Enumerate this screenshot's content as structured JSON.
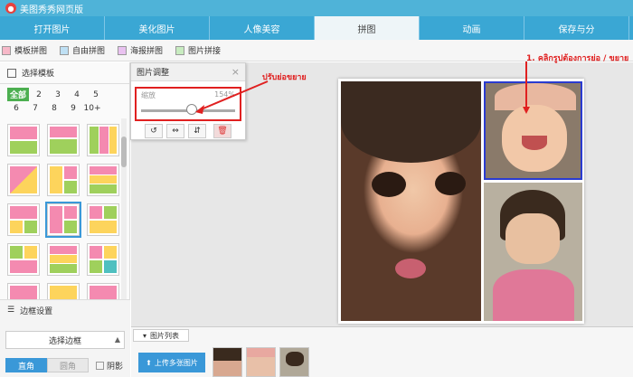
{
  "titlebar": {
    "title": "美图秀秀网页版"
  },
  "tabs": [
    "打开图片",
    "美化图片",
    "人像美容",
    "拼图",
    "动画",
    "保存与分"
  ],
  "toolbar": {
    "items": [
      "模板拼图",
      "自由拼图",
      "海报拼图",
      "图片拼接"
    ]
  },
  "left": {
    "title": "选择模板",
    "nums": [
      "全部",
      "2",
      "3",
      "4",
      "5",
      "6",
      "7",
      "8",
      "9",
      "10+"
    ],
    "border_settings": "边框设置",
    "border_select": "选择边框",
    "shape_straight": "直角",
    "shape_round": "圆角",
    "shadow": "阴影"
  },
  "panel": {
    "title": "图片调整",
    "zoom_label": "缩放",
    "zoom_value": "154%",
    "close": "×"
  },
  "annotations": {
    "zoom": "ปรับย่อขยาย",
    "photo": "1. คลิกรูปต้องการย่อ / ขยาย"
  },
  "bottom": {
    "tab": "图片列表",
    "upload": "上传多张图片"
  },
  "colors": {
    "accent": "#3aa7d4",
    "highlight": "#e02020",
    "active_num": "#4caf50"
  }
}
